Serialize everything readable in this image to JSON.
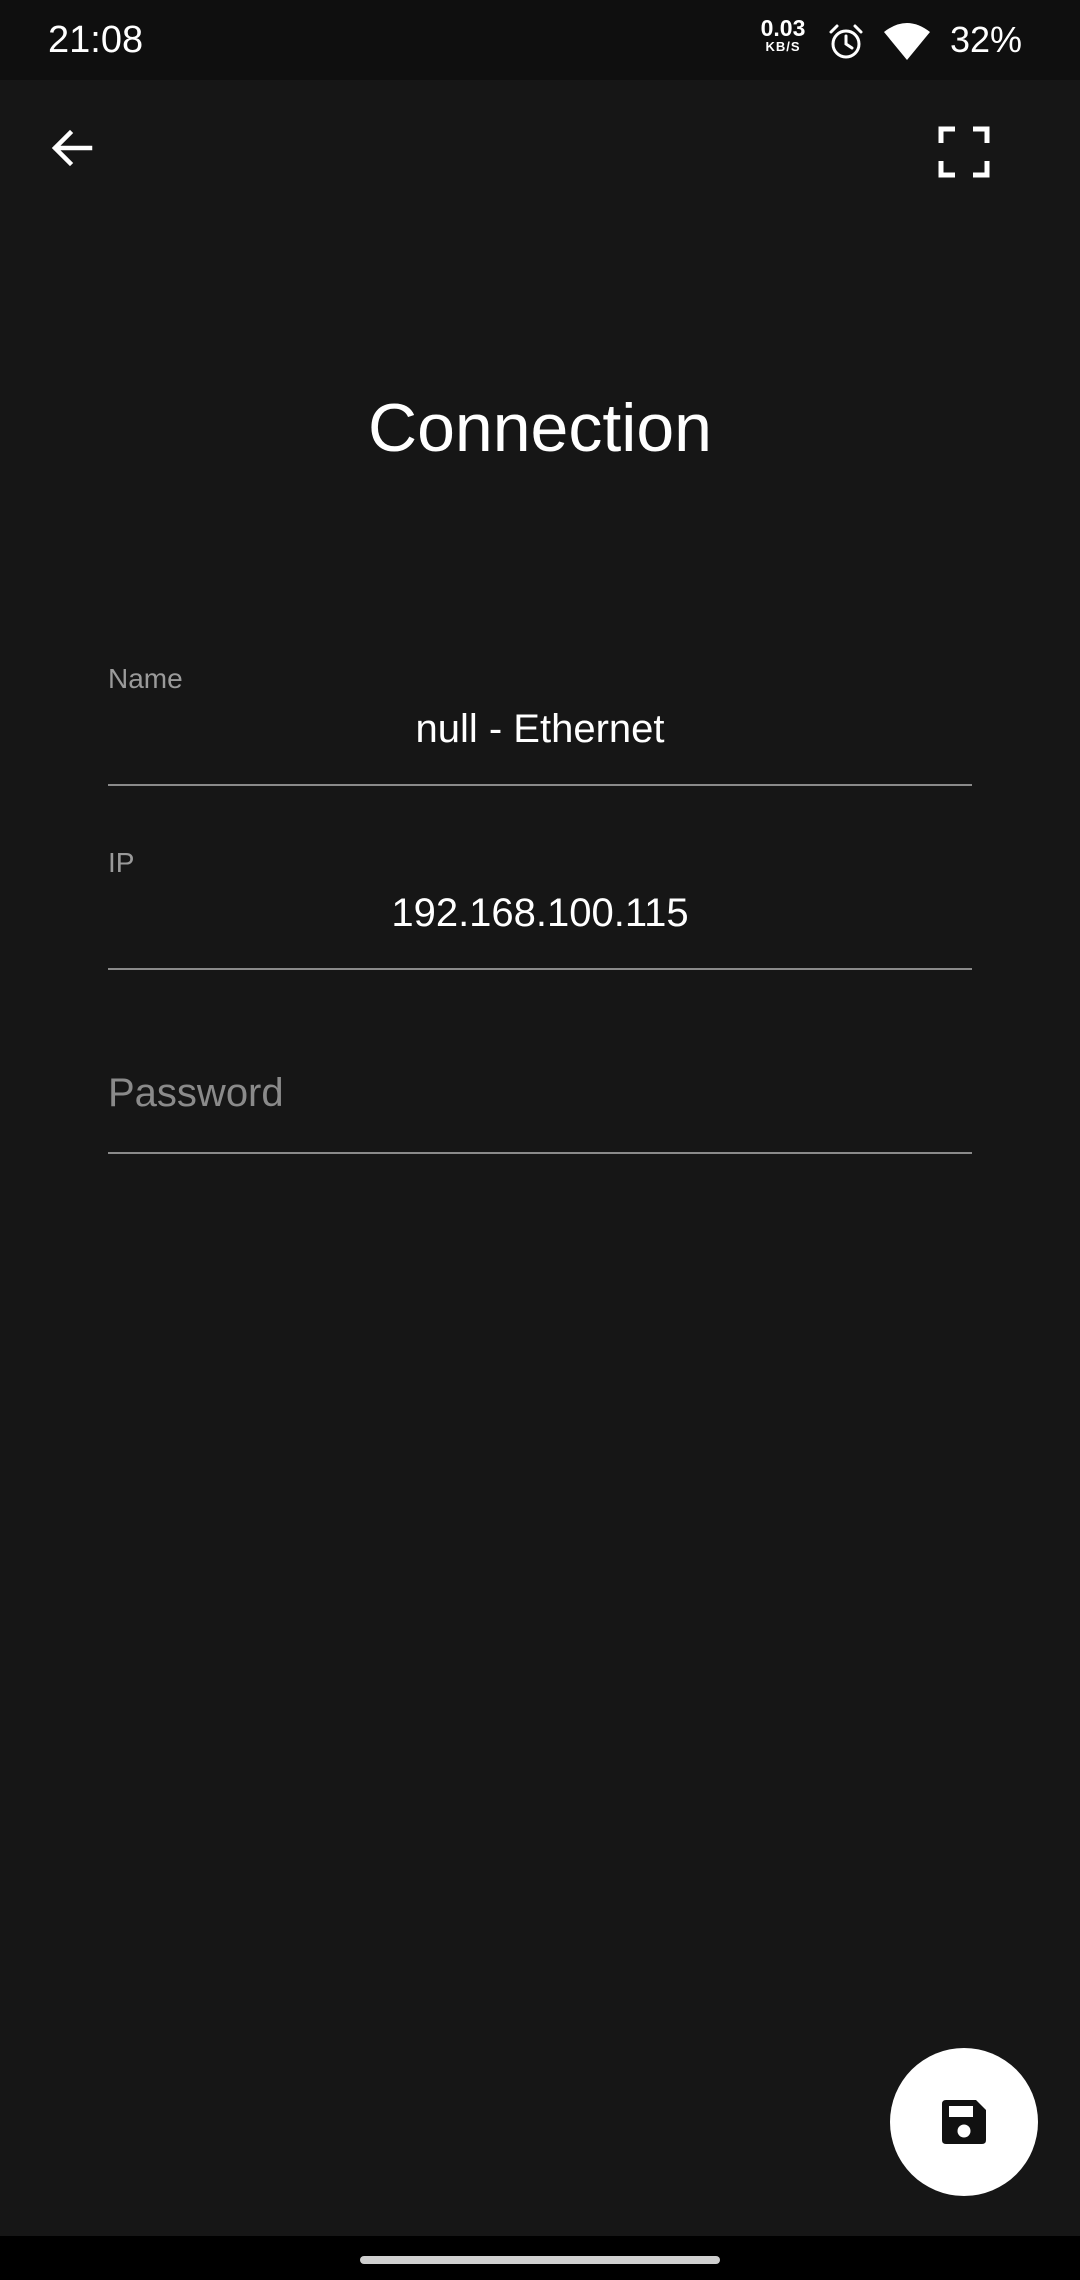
{
  "status_bar": {
    "time": "21:08",
    "net_speed_value": "0.03",
    "net_speed_unit": "KB/S",
    "icons": [
      "alarm-icon",
      "wifi-icon"
    ],
    "battery": "32%"
  },
  "app_bar": {
    "back_icon": "arrow-left-icon",
    "fullscreen_icon": "fullscreen-icon"
  },
  "page": {
    "title": "Connection"
  },
  "form": {
    "name": {
      "label": "Name",
      "value": "null - Ethernet"
    },
    "ip": {
      "label": "IP",
      "value": "192.168.100.115"
    },
    "password": {
      "placeholder": "Password",
      "value": ""
    }
  },
  "fab": {
    "icon": "save-icon"
  },
  "colors": {
    "background": "#161616",
    "status_bar": "#0f0f0f",
    "text": "#ffffff",
    "label": "#9a9a9a",
    "underline": "#8a8a8a",
    "fab": "#ffffff"
  }
}
